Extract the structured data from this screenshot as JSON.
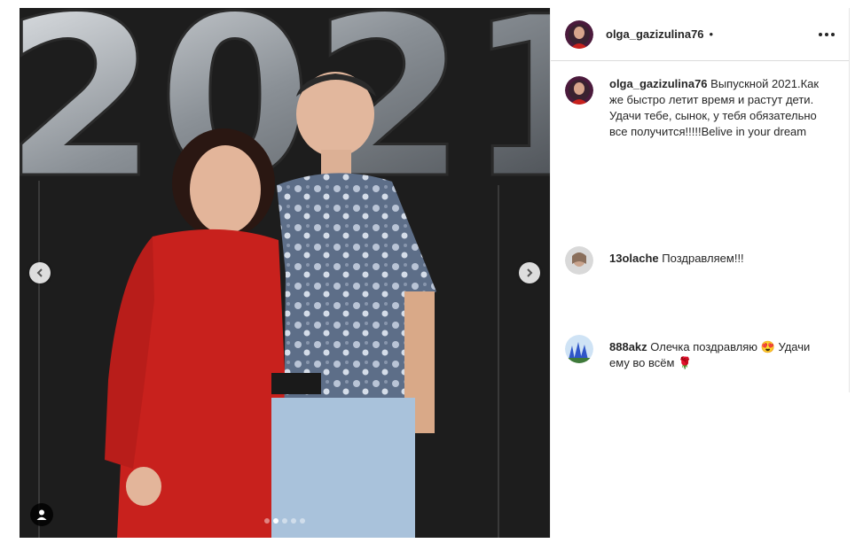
{
  "post": {
    "author": "olga_gazizulina76",
    "header_separator": "•",
    "more_icon": "more-horizontal-icon",
    "caption": "Выпускной 2021.Как же быстро летит время и растут дети. Удачи тебе, сынок, у тебя обязательно все получится!!!!!Belive in your dream",
    "photo_text": "2021",
    "carousel": {
      "count": 5,
      "active_index": 1
    }
  },
  "comments": [
    {
      "user": "13olache",
      "text": "Поздравляем!!!"
    },
    {
      "user": "888akz",
      "text": "Олечка поздравляю 😍 Удачи ему во всём 🌹"
    }
  ],
  "colors": {
    "dress": "#c8211d",
    "background_dark": "#1c1c1c",
    "balloon": "#9aa0a6"
  }
}
